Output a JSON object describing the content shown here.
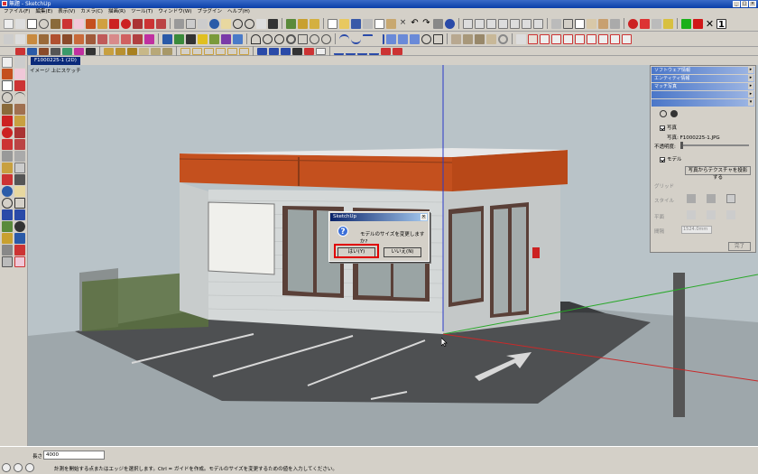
{
  "window": {
    "title": "無題 - SketchUp"
  },
  "menu": [
    "ファイル(F)",
    "編集(E)",
    "表示(V)",
    "カメラ(C)",
    "描画(R)",
    "ツール(T)",
    "ウィンドウ(W)",
    "プラグイン",
    "ヘルプ(H)"
  ],
  "scene_tab": {
    "label": "F1000225-1 (2D)"
  },
  "scene_label": "イメージ 上にスケッチ",
  "dialog": {
    "title": "SketchUp",
    "message": "モデルのサイズを変更しますか?",
    "yes_label": "はい(Y)",
    "no_label": "いいえ(N)"
  },
  "tray": {
    "section_headers": [
      "ソフトウェア情報",
      "エンティティ情報",
      "マッチ写真"
    ],
    "photo_label": "写真",
    "photo_file": "写真: F1000225-1.JPG",
    "opacity_label": "不透明度:",
    "model_label": "モデル",
    "project_button": "写真からテクスチャを投影する",
    "grid_label": "グリッド",
    "style_label": "スタイル",
    "plane_label": "平面",
    "spacing_label": "間隔",
    "spacing_value": "1524.0mm",
    "done_button": "完了"
  },
  "status": {
    "measure_label": "長さ",
    "measure_value": "4000",
    "message": "計測を開始する点またはエッジを選択します。Ctrl = ガイドを作成。モデルのサイズを変更するための値を入力してください。"
  },
  "colors": {
    "title_blue": "#0a246a",
    "facade_orange": "#c4501e",
    "highlight_red": "#e00000",
    "sky": "#b9c3c8",
    "ground": "#5a5a5a"
  }
}
